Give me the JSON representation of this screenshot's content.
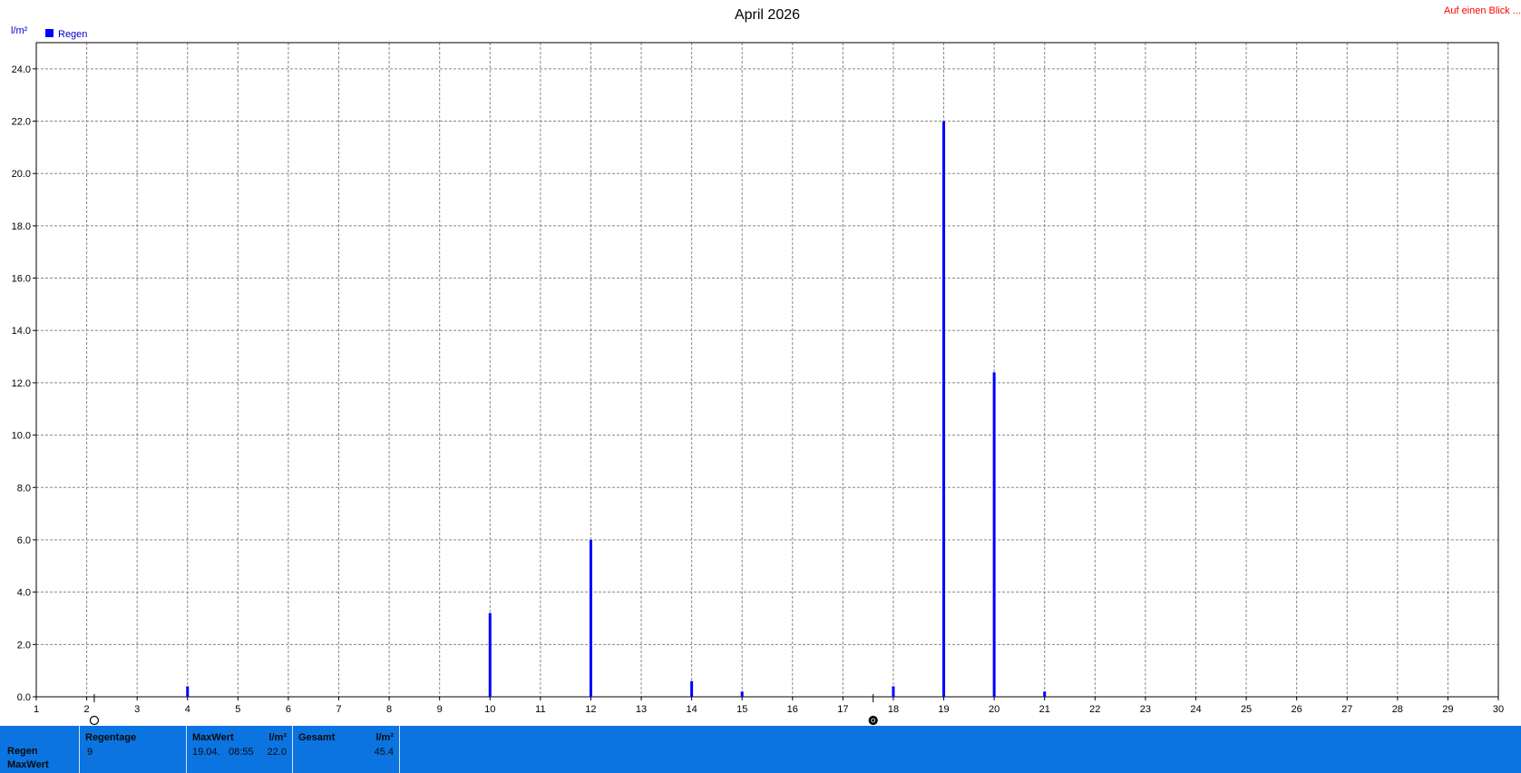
{
  "header": {
    "link": "Auf einen Blick ..."
  },
  "chart_data": {
    "type": "bar",
    "title": "April 2026",
    "ylabel": "l/m²",
    "xlabel": "",
    "ylim": [
      0,
      25
    ],
    "yticks": [
      "0.0",
      "2.0",
      "4.0",
      "6.0",
      "8.0",
      "10.0",
      "12.0",
      "14.0",
      "16.0",
      "18.0",
      "20.0",
      "22.0",
      "24.0"
    ],
    "xticks": [
      "1",
      "2",
      "3",
      "4",
      "5",
      "6",
      "7",
      "8",
      "9",
      "10",
      "11",
      "12",
      "13",
      "14",
      "15",
      "16",
      "17",
      "18",
      "19",
      "20",
      "21",
      "22",
      "23",
      "24",
      "25",
      "26",
      "27",
      "28",
      "29",
      "30"
    ],
    "legend": {
      "placement": "top-left",
      "entries": [
        "Regen"
      ]
    },
    "grid": true,
    "series": [
      {
        "name": "Regen",
        "color": "#0000ff",
        "points": [
          {
            "x": 4,
            "y": 0.4
          },
          {
            "x": 10,
            "y": 3.2
          },
          {
            "x": 12,
            "y": 6.0
          },
          {
            "x": 14,
            "y": 0.6
          },
          {
            "x": 15,
            "y": 0.2
          },
          {
            "x": 18,
            "y": 0.4
          },
          {
            "x": 19,
            "y": 22.0
          },
          {
            "x": 20,
            "y": 12.4
          },
          {
            "x": 21,
            "y": 0.2
          }
        ]
      }
    ],
    "moon_markers": [
      {
        "x": 2.15,
        "phase": "new-moon"
      },
      {
        "x": 17.6,
        "phase": "full-moon"
      }
    ]
  },
  "footer": {
    "row_labels": [
      "Regen",
      "MaxWert"
    ],
    "regentage": {
      "header": "Regentage",
      "value": "9"
    },
    "maxwert": {
      "header": "MaxWert",
      "unit": "l/m²",
      "date": "19.04.",
      "time": "08:55",
      "value": "22.0"
    },
    "gesamt": {
      "header": "Gesamt",
      "unit": "l/m²",
      "value": "45.4"
    }
  }
}
